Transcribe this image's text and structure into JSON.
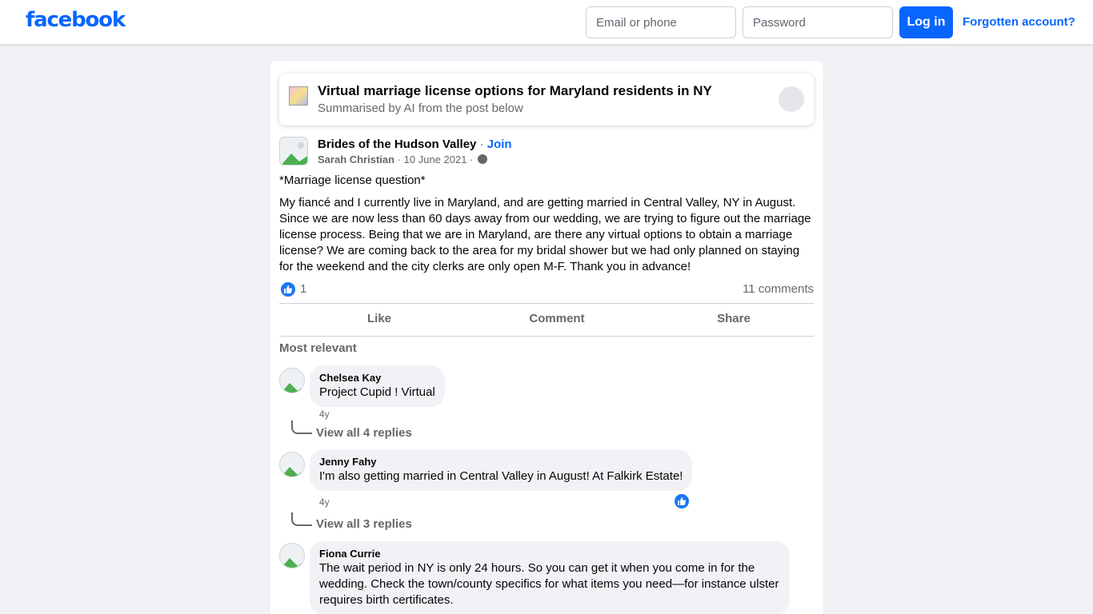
{
  "header": {
    "logo": "facebook",
    "email_placeholder": "Email or phone",
    "password_placeholder": "Password",
    "login_label": "Log in",
    "forgot_label": "Forgotten account?"
  },
  "ai_summary": {
    "title": "Virtual marriage license options for Maryland residents in NY",
    "subtitle": "Summarised by AI from the post below"
  },
  "post": {
    "group": "Brides of the Hudson Valley",
    "separator": " · ",
    "join_label": "Join",
    "author": "Sarah Christian",
    "date": "10 June 2021",
    "meta_separator": " · ",
    "question": "*Marriage license question*",
    "body": "My fiancé and I currently live in Maryland, and are getting married in Central Valley, NY in August. Since we are now less than 60 days away from our wedding, we are trying to figure out the marriage license process. Being that we are in Maryland, are there any virtual options to obtain a marriage license? We are coming back to the area for my bridal shower but we had only planned on staying for the weekend and the city clerks are only open M-F. Thank you in advance!",
    "like_count": "1",
    "comments_count": "11 comments",
    "actions": {
      "like": "Like",
      "comment": "Comment",
      "share": "Share"
    }
  },
  "comments_section": {
    "sort_label": "Most relevant",
    "comments": [
      {
        "name": "Chelsea Kay",
        "text": "Project Cupid ! Virtual",
        "time": "4y",
        "replies": "View all 4 replies"
      },
      {
        "name": "Jenny Fahy",
        "text": "I'm also getting married in Central Valley in August! At Falkirk Estate!",
        "time": "4y",
        "replies": "View all 3 replies"
      },
      {
        "name": "Fiona Currie",
        "text": "The wait period in NY is only 24 hours. So you can get it when you come in for the wedding. Check the town/county specifics for what items you need—for instance ulster requires birth certificates.",
        "time": "",
        "replies": ""
      }
    ]
  },
  "colors": {
    "brand": "#0866ff",
    "background": "#f0f2f5",
    "secondary_text": "#65676b"
  }
}
